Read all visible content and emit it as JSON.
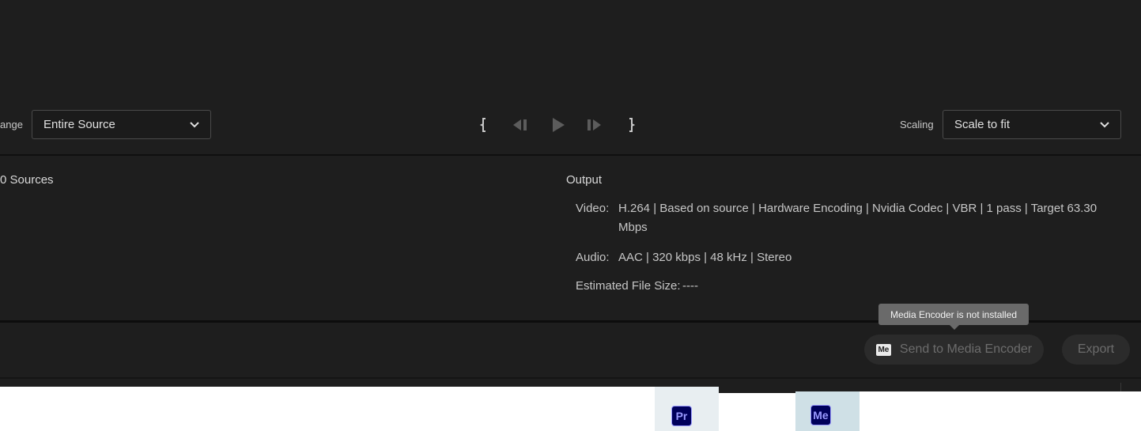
{
  "controls": {
    "range_label": "ange",
    "range_value": "Entire Source",
    "scaling_label": "Scaling",
    "scaling_value": "Scale to fit"
  },
  "transport": {
    "icons": [
      "mark-in-icon",
      "step-back-icon",
      "play-icon",
      "step-forward-icon",
      "mark-out-icon"
    ]
  },
  "info": {
    "sources_title": "0 Sources",
    "output_title": "Output",
    "video_label": "Video:",
    "video_value": "H.264 | Based on source | Hardware Encoding | Nvidia Codec  | VBR | 1 pass | Target 63.30 Mbps",
    "audio_label": "Audio:",
    "audio_value": "AAC | 320 kbps | 48 kHz | Stereo",
    "size_label": "Estimated File Size:",
    "size_value": "----"
  },
  "actions": {
    "tooltip": "Media Encoder is not installed",
    "send_badge": "Me",
    "send_label": "Send to Media Encoder",
    "export_label": "Export"
  },
  "taskbar": {
    "pr_icon": "Pr",
    "me_icon": "Me"
  },
  "colors": {
    "background": "#1e1e1e",
    "disabled_button": "#2b2b2b",
    "tooltip": "#6a6a6a",
    "adobe_icon_bg": "#00005b",
    "adobe_icon_fg": "#9999ff"
  }
}
